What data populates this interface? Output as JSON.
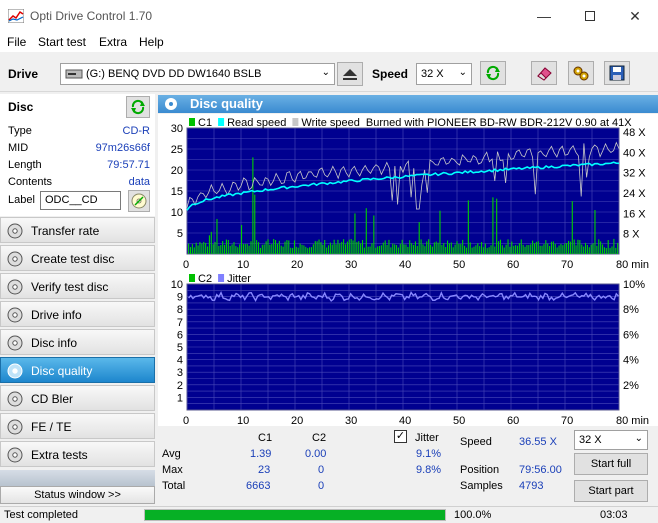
{
  "window": {
    "title": "Opti Drive Control 1.70"
  },
  "menu": [
    "File",
    "Start test",
    "Extra",
    "Help"
  ],
  "drive": {
    "label": "Drive",
    "selected": "(G:)   BENQ DVD DD DW1640 BSLB",
    "speed_label": "Speed",
    "speed": "32 X"
  },
  "disc": {
    "heading": "Disc",
    "rows": [
      {
        "k": "Type",
        "v": "CD-R"
      },
      {
        "k": "MID",
        "v": "97m26s66f"
      },
      {
        "k": "Length",
        "v": "79:57.71"
      },
      {
        "k": "Contents",
        "v": "data"
      }
    ],
    "label_key": "Label",
    "label_value": "ODC__CD"
  },
  "nav": [
    {
      "name": "transfer-rate",
      "label": "Transfer rate"
    },
    {
      "name": "create-test-disc",
      "label": "Create test disc"
    },
    {
      "name": "verify-test-disc",
      "label": "Verify test disc"
    },
    {
      "name": "drive-info",
      "label": "Drive info"
    },
    {
      "name": "disc-info",
      "label": "Disc info"
    },
    {
      "name": "disc-quality",
      "label": "Disc quality",
      "active": true
    },
    {
      "name": "cd-bler",
      "label": "CD Bler"
    },
    {
      "name": "fe-te",
      "label": "FE / TE"
    },
    {
      "name": "extra-tests",
      "label": "Extra tests"
    }
  ],
  "status_window_label": "Status window >>",
  "panel_title": "Disc quality",
  "chart_data": [
    {
      "type": "bar",
      "legend": [
        {
          "label": "C1",
          "color": "#00c000"
        },
        {
          "label": "Read speed",
          "color": "#00ffff"
        },
        {
          "label": "Write speed",
          "color": "#c8c8c8"
        },
        {
          "label": "Burned with PIONEER BD-RW   BDR-212V 0.90 at 41X",
          "color": ""
        }
      ],
      "x_ticks": [
        "0",
        "10",
        "20",
        "30",
        "40",
        "50",
        "60",
        "70",
        "80 min"
      ],
      "y_left_ticks": [
        "5",
        "10",
        "15",
        "20",
        "25",
        "30"
      ],
      "y_right_ticks": [
        "8 X",
        "16 X",
        "24 X",
        "32 X",
        "40 X",
        "48 X"
      ],
      "xlim": [
        0,
        80
      ],
      "ylim": [
        0,
        30
      ],
      "read_speed_x": [
        0,
        10,
        20,
        30,
        40,
        50,
        60,
        70,
        80
      ],
      "read_speed_y": [
        10.5,
        12.5,
        14.2,
        15.6,
        17,
        18.2,
        19.5,
        20.6,
        21.7
      ],
      "write_speed_x": [
        0,
        10,
        20,
        30,
        40,
        50,
        60,
        70,
        80
      ],
      "write_speed_y": [
        11.5,
        14.5,
        16.8,
        18.6,
        20.2,
        21.6,
        23,
        24.2,
        25.2
      ],
      "c1_baseline": 1.4,
      "c1_max": 23
    },
    {
      "type": "line",
      "legend": [
        {
          "label": "C2",
          "color": "#00c000"
        },
        {
          "label": "Jitter",
          "color": "#8080ff"
        }
      ],
      "x_ticks": [
        "0",
        "10",
        "20",
        "30",
        "40",
        "50",
        "60",
        "70",
        "80 min"
      ],
      "y_left_ticks": [
        "1",
        "2",
        "3",
        "4",
        "5",
        "6",
        "7",
        "8",
        "9",
        "10"
      ],
      "y_right_ticks": [
        "2%",
        "4%",
        "6%",
        "8%",
        "10%"
      ],
      "xlim": [
        0,
        80
      ],
      "ylim": [
        0,
        10
      ],
      "jitter_avg_pct": 9.1,
      "jitter_max_pct": 9.8
    }
  ],
  "stats": {
    "col_c1": "C1",
    "col_c2": "C2",
    "jitter_label": "Jitter",
    "rows": [
      {
        "k": "Avg",
        "c1": "1.39",
        "c2": "0.00",
        "j": "9.1%"
      },
      {
        "k": "Max",
        "c1": "23",
        "c2": "0",
        "j": "9.8%"
      },
      {
        "k": "Total",
        "c1": "6663",
        "c2": "0",
        "j": ""
      }
    ],
    "speed_label": "Speed",
    "speed_value": "36.55 X",
    "position_label": "Position",
    "position_value": "79:56.00",
    "samples_label": "Samples",
    "samples_value": "4793",
    "speed_select": "32 X",
    "start_full": "Start full",
    "start_part": "Start part"
  },
  "status": {
    "text": "Test completed",
    "progress_pct": 100,
    "progress_text": "100.0%",
    "time": "03:03"
  }
}
